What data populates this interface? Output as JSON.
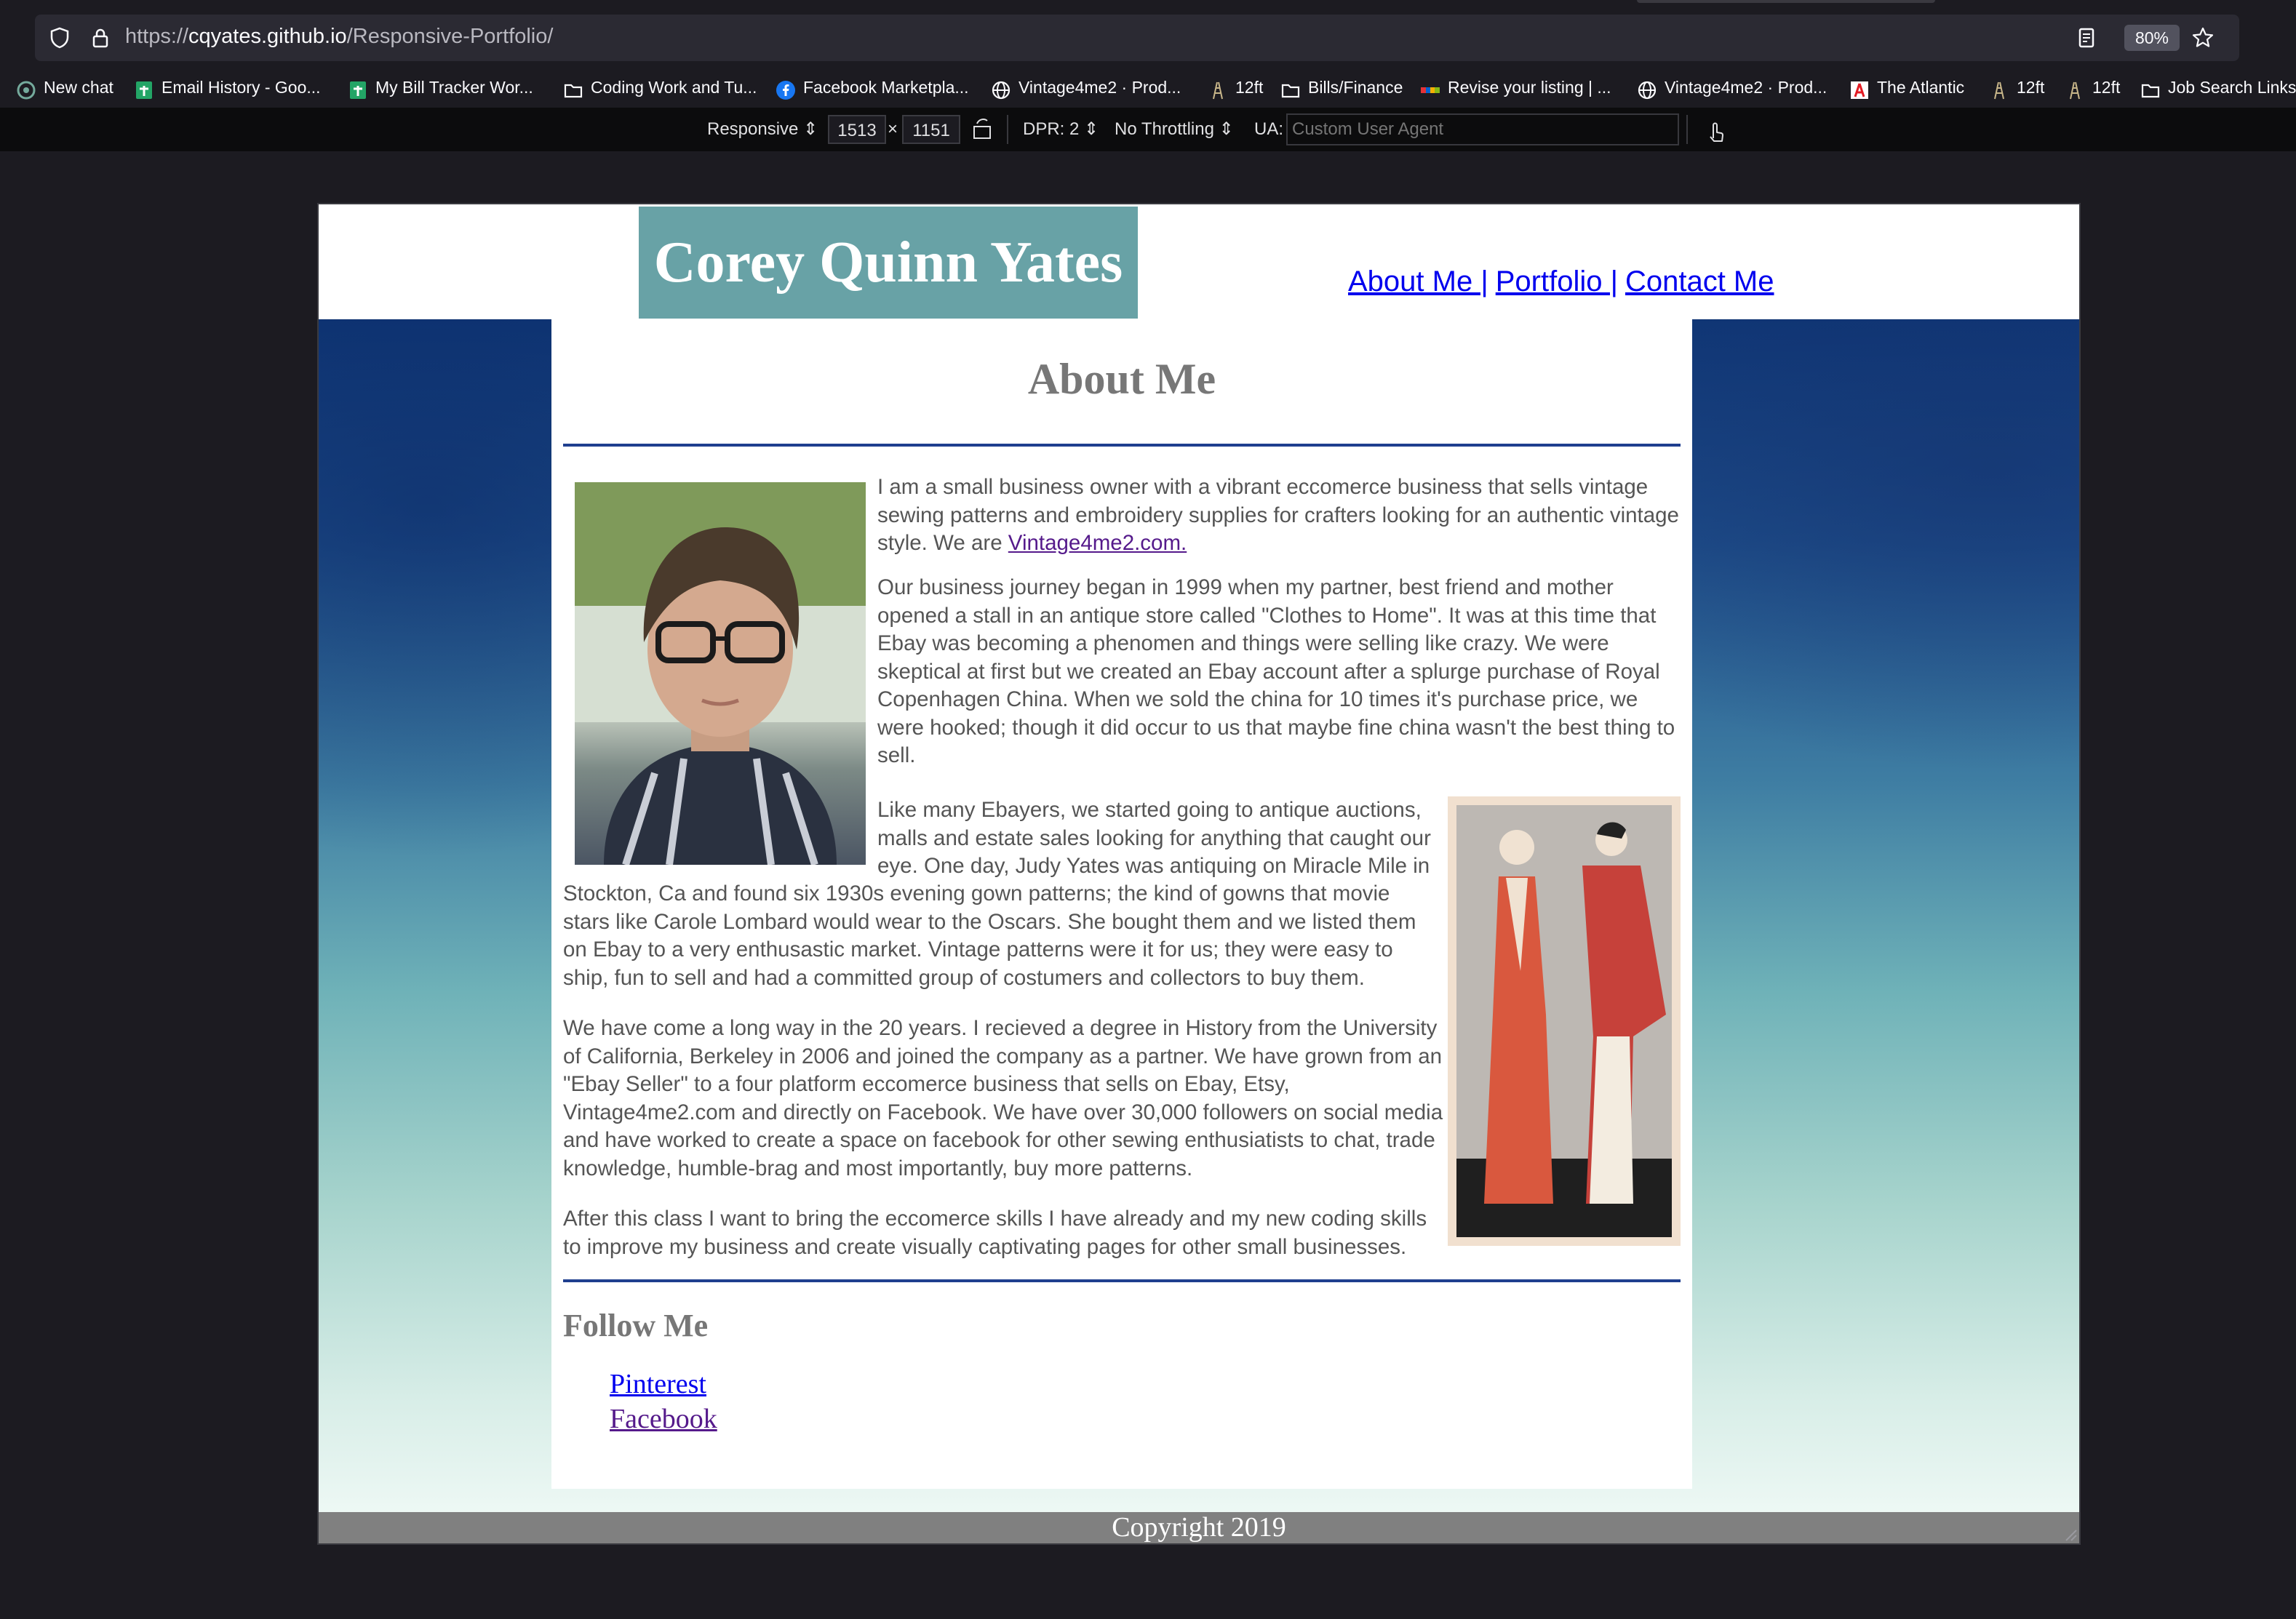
{
  "browser": {
    "url_scheme": "https://",
    "url_host": "cqyates.github.io",
    "url_path": "/Responsive-Portfolio/",
    "zoom": "80%",
    "bookmarks": [
      {
        "label": "New chat",
        "icon": "chat-icon"
      },
      {
        "label": "Email History - Goo...",
        "icon": "sheets-icon"
      },
      {
        "label": "My Bill Tracker Wor...",
        "icon": "sheets-icon"
      },
      {
        "label": "Coding Work and Tu...",
        "icon": "folder-icon"
      },
      {
        "label": "Facebook Marketpla...",
        "icon": "facebook-icon"
      },
      {
        "label": "Vintage4me2 · Prod...",
        "icon": "globe-icon"
      },
      {
        "label": "12ft",
        "icon": "ladder-icon"
      },
      {
        "label": "Bills/Finance",
        "icon": "folder-icon"
      },
      {
        "label": "Revise your listing | ...",
        "icon": "ebay-icon"
      },
      {
        "label": "Vintage4me2 · Prod...",
        "icon": "globe-icon"
      },
      {
        "label": "The Atlantic",
        "icon": "atlantic-icon"
      },
      {
        "label": "12ft",
        "icon": "ladder-icon"
      },
      {
        "label": "12ft",
        "icon": "ladder-icon"
      },
      {
        "label": "Job Search Links",
        "icon": "folder-icon"
      }
    ]
  },
  "devtools": {
    "device": "Responsive",
    "width": "1513",
    "times": "×",
    "height": "1151",
    "dpr": "DPR: 2",
    "throttling": "No Throttling",
    "ua_label": "UA:",
    "ua_placeholder": "Custom User Agent"
  },
  "site": {
    "name": "Corey Quinn Yates",
    "nav": [
      "About Me |",
      "Portfolio |",
      "Contact Me"
    ],
    "about_title": "About Me",
    "p1_before": "I am a small business owner with a vibrant eccomerce business that sells vintage sewing patterns and embroidery supplies for crafters looking for an authentic vintage style. We are ",
    "p1_link": "Vintage4me2.com.",
    "p2": "Our business journey began in 1999 when my partner, best friend and mother opened a stall in an antique store called \"Clothes to Home\". It was at this time that Ebay was becoming a phenomen and things were selling like crazy. We were skeptical at first but we created an Ebay account after a splurge purchase of Royal Copenhagen China. When we sold the china for 10 times it's purchase price, we were hooked; though it did occur to us that maybe fine china wasn't the best thing to sell.",
    "p3a": "Like many Ebayers, we started going to antique auctions, malls and estate sales looking for anything that caught our eye. One day, Judy Yates was antiquing on Miracle Mile in",
    "p3b": "Stockton, Ca and found six 1930s evening gown patterns; the kind of gowns that movie stars like Carole Lombard would wear to the Oscars. She bought them and we listed them on Ebay to a very enthusastic market. Vintage patterns were it for us; they were easy to ship, fun to sell and had a committed group of costumers and collectors to buy them.",
    "p4": "We have come a long way in the 20 years. I recieved a degree in History from the University of California, Berkeley in 2006 and joined the company as a partner. We have grown from an \"Ebay Seller\" to a four platform eccomerce business that sells on Ebay, Etsy, Vintage4me2.com and directly on Facebook. We have over 30,000 followers on social media and have worked to create a space on facebook for other sewing enthusiatists to chat, trade knowledge, humble-brag and most importantly, buy more patterns.",
    "p5": "After this class I want to bring the eccomerce skills I have already and my new coding skills to improve my business and create visually captivating pages for other small businesses.",
    "follow_title": "Follow Me",
    "social": [
      "Pinterest",
      "Facebook"
    ],
    "footer": "Copyright 2019"
  }
}
